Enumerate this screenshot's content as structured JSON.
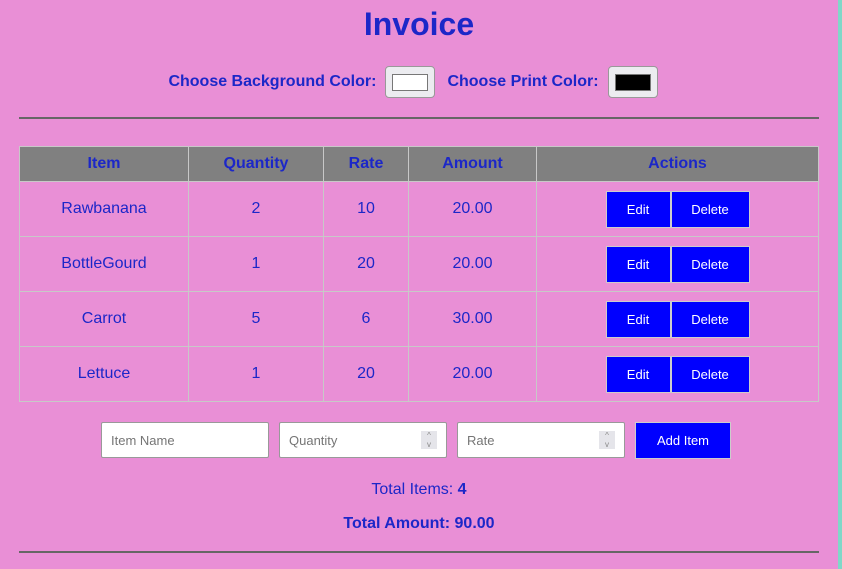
{
  "title": "Invoice",
  "bg_label": "Choose Background Color:",
  "print_label": "Choose Print Color:",
  "bg_color": "#ffffff",
  "print_color": "#000000",
  "columns": [
    "Item",
    "Quantity",
    "Rate",
    "Amount",
    "Actions"
  ],
  "rows": [
    {
      "item": "Rawbanana",
      "qty": "2",
      "rate": "10",
      "amount": "20.00"
    },
    {
      "item": "BottleGourd",
      "qty": "1",
      "rate": "20",
      "amount": "20.00"
    },
    {
      "item": "Carrot",
      "qty": "5",
      "rate": "6",
      "amount": "30.00"
    },
    {
      "item": "Lettuce",
      "qty": "1",
      "rate": "20",
      "amount": "20.00"
    }
  ],
  "edit_label": "Edit",
  "delete_label": "Delete",
  "form": {
    "item_placeholder": "Item Name",
    "qty_placeholder": "Quantity",
    "rate_placeholder": "Rate",
    "add_label": "Add Item"
  },
  "totals": {
    "items_label": "Total Items:",
    "items_value": "4",
    "amount_label": "Total Amount:",
    "amount_value": "90.00"
  }
}
